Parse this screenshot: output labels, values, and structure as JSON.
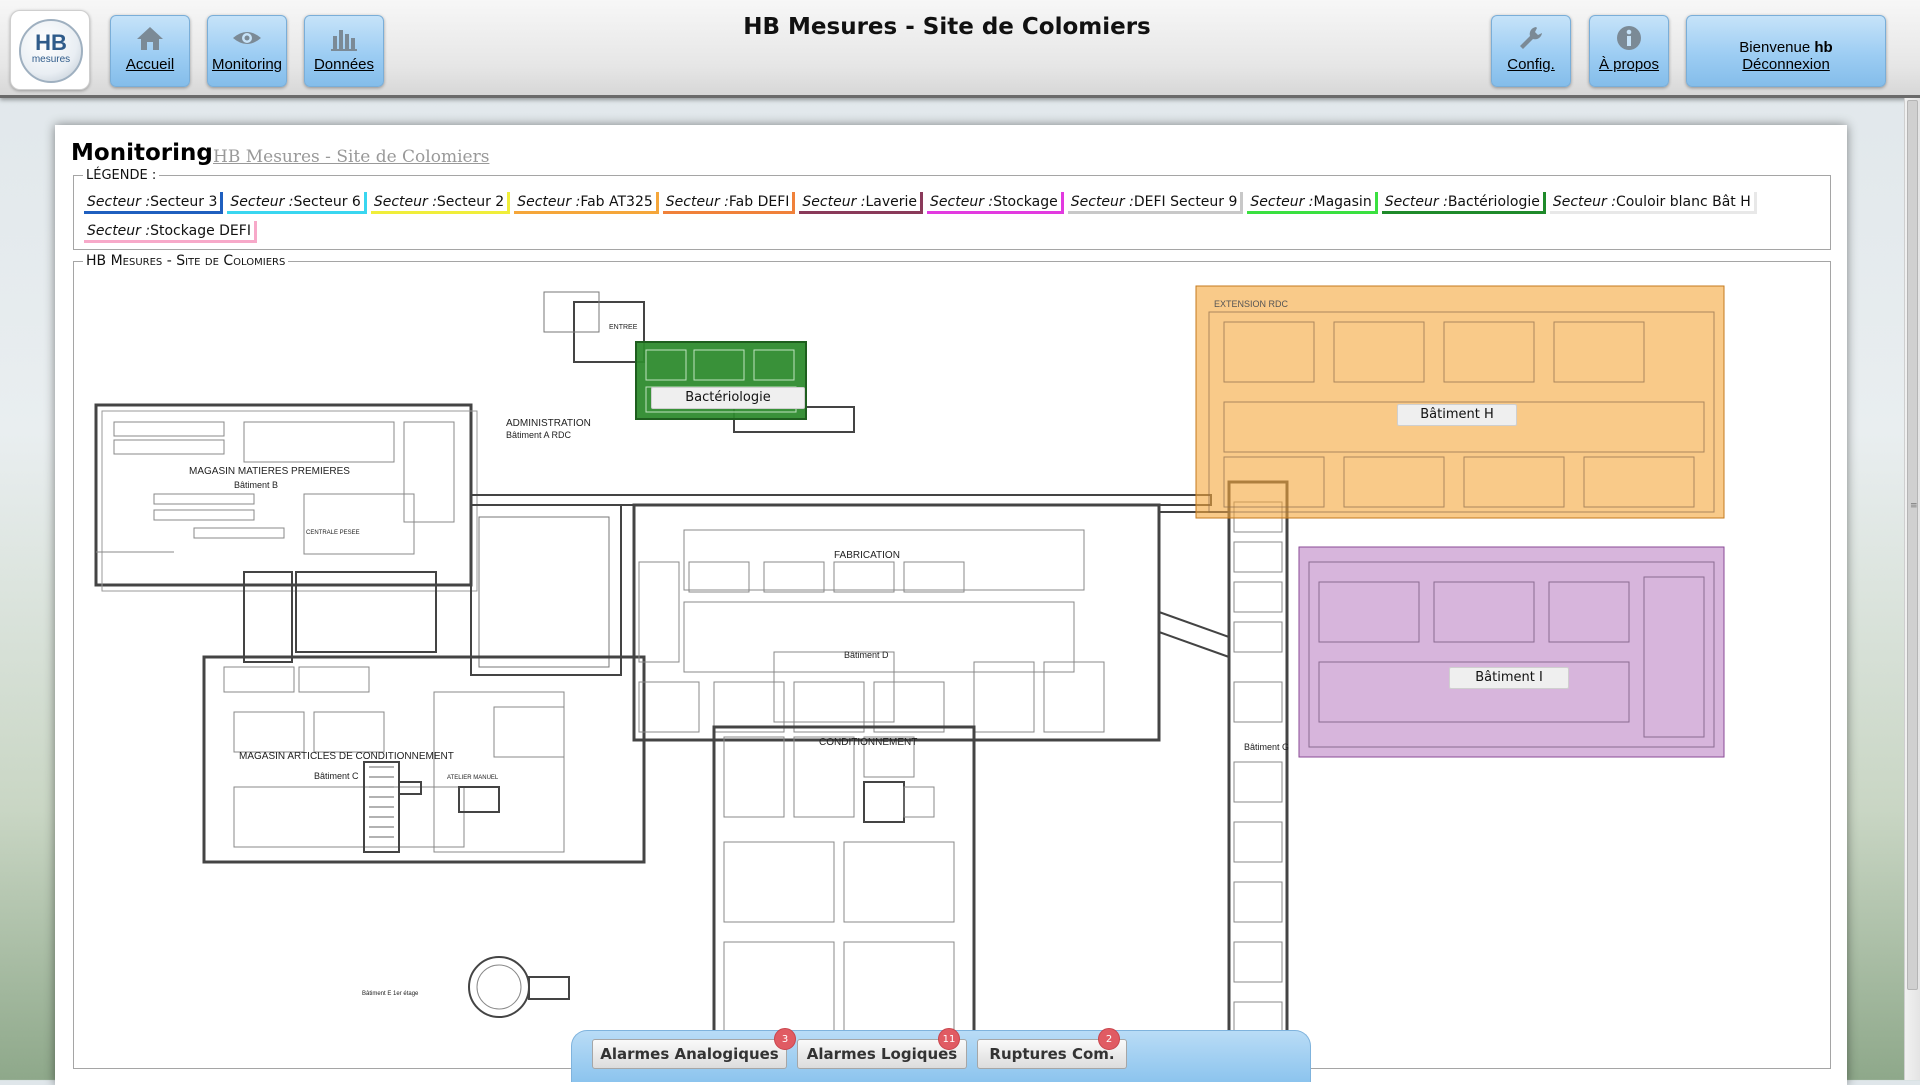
{
  "header": {
    "title": "HB Mesures - Site de Colomiers",
    "logo_text": "HB",
    "logo_subtext": "mesures",
    "nav": [
      {
        "label": "Accueil",
        "icon": "home-icon"
      },
      {
        "label": "Monitoring",
        "icon": "eye-icon"
      },
      {
        "label": "Données",
        "icon": "bar-chart-icon"
      }
    ],
    "config_label": "Config.",
    "about_label": "À propos",
    "welcome_prefix": "Bienvenue",
    "username": "hb",
    "logout_label": "Déconnexion"
  },
  "page": {
    "heading": "Monitoring",
    "breadcrumb": "HB Mesures - Site de Colomiers"
  },
  "legend": {
    "title": "LÉGENDE :",
    "prefix": "Secteur :",
    "sectors": [
      {
        "name": "Secteur 3",
        "color": "#1f5fbf"
      },
      {
        "name": "Secteur 6",
        "color": "#39d6f0"
      },
      {
        "name": "Secteur 2",
        "color": "#f0ee3a"
      },
      {
        "name": "Fab AT325",
        "color": "#f5a63a"
      },
      {
        "name": "Fab DEFI",
        "color": "#f0813a"
      },
      {
        "name": "Laverie",
        "color": "#8a3a5a"
      },
      {
        "name": "Stockage",
        "color": "#e23ae0"
      },
      {
        "name": "DEFI Secteur 9",
        "color": "#c8c8c8"
      },
      {
        "name": "Magasin",
        "color": "#3ae040"
      },
      {
        "name": "Bactériologie",
        "color": "#1f8a2a"
      },
      {
        "name": "Couloir blanc Bât H",
        "color": "#e8e8e8"
      },
      {
        "name": "Stockage DEFI",
        "color": "#f7a9c9"
      }
    ]
  },
  "plan": {
    "title": "HB Mesures - Site de Colomiers",
    "zones": [
      {
        "label": "Bactériologie",
        "color": "#1f8a2a"
      },
      {
        "label": "Bâtiment H",
        "color": "#f5a63a"
      },
      {
        "label": "Bâtiment I",
        "color": "#b678c0"
      }
    ],
    "labels": {
      "extension": "EXTENSION RDC",
      "entree": "ENTREE",
      "admin": "ADMINISTRATION",
      "admin_sub": "Bâtiment A RDC",
      "magasin_mp": "MAGASIN MATIERES PREMIERES",
      "bat_b": "Bâtiment B",
      "centrale": "CENTRALE PESEE",
      "fabrication": "FABRICATION",
      "bat_d": "Bâtiment D",
      "conditionnement": "CONDITIONNEMENT",
      "magasin_ac": "MAGASIN ARTICLES DE CONDITIONNEMENT",
      "bat_c": "Bâtiment C",
      "atelier": "ATELIER MANUEL",
      "bat_g": "Bâtiment G",
      "bat_e": "Bâtiment E 1er étage"
    }
  },
  "alarms": [
    {
      "label": "Alarmes Analogiques",
      "count": "3"
    },
    {
      "label": "Alarmes Logiques",
      "count": "11"
    },
    {
      "label": "Ruptures Com.",
      "count": "2"
    }
  ]
}
